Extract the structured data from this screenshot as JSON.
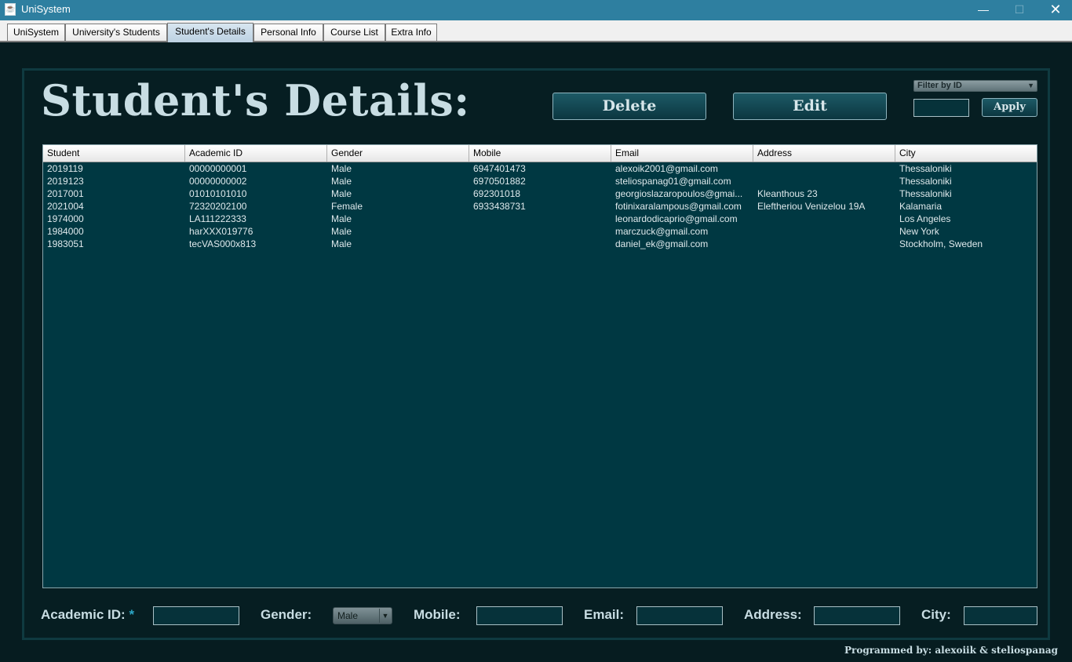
{
  "window": {
    "title": "UniSystem",
    "minimize_glyph": "—",
    "maximize_glyph": "☐",
    "close_glyph": "✕"
  },
  "tabs": [
    {
      "label": "UniSystem",
      "active": false
    },
    {
      "label": "University's Students",
      "active": false
    },
    {
      "label": "Student's Details",
      "active": true
    },
    {
      "label": "Personal Info",
      "active": false
    },
    {
      "label": "Course List",
      "active": false
    },
    {
      "label": "Extra Info",
      "active": false
    }
  ],
  "page": {
    "title": "Student's Details:",
    "delete_label": "Delete",
    "edit_label": "Edit",
    "filter": {
      "selected": "Filter by ID",
      "value": "",
      "apply_label": "Apply"
    }
  },
  "table": {
    "columns": [
      "Student",
      "Academic ID",
      "Gender",
      "Mobile",
      "Email",
      "Address",
      "City"
    ],
    "rows": [
      [
        "2019119",
        "00000000001",
        "Male",
        "6947401473",
        "alexoik2001@gmail.com",
        "",
        "Thessaloniki"
      ],
      [
        "2019123",
        "00000000002",
        "Male",
        "6970501882",
        "steliospanag01@gmail.com",
        "",
        "Thessaloniki"
      ],
      [
        "2017001",
        "01010101010",
        "Male",
        "692301018",
        "georgioslazaropoulos@gmai...",
        "Kleanthous 23",
        "Thessaloniki"
      ],
      [
        "2021004",
        "72320202100",
        "Female",
        "6933438731",
        "fotinixaralampous@gmail.com",
        "Eleftheriou Venizelou 19A",
        "Kalamaria"
      ],
      [
        "1974000",
        "LA111222333",
        "Male",
        "",
        "leonardodicaprio@gmail.com",
        "",
        "Los Angeles"
      ],
      [
        "1984000",
        "harXXX019776",
        "Male",
        "",
        "marczuck@gmail.com",
        "",
        "New York"
      ],
      [
        "1983051",
        "tecVAS000x813",
        "Male",
        "",
        "daniel_ek@gmail.com",
        "",
        "Stockholm, Sweden"
      ]
    ]
  },
  "form": {
    "academic_id_label": "Academic ID:",
    "required_mark": "*",
    "gender_label": "Gender:",
    "gender_selected": "Male",
    "mobile_label": "Mobile:",
    "email_label": "Email:",
    "address_label": "Address:",
    "city_label": "City:"
  },
  "footer": {
    "credit": "Programmed by: alexoiik & steliospanag"
  }
}
